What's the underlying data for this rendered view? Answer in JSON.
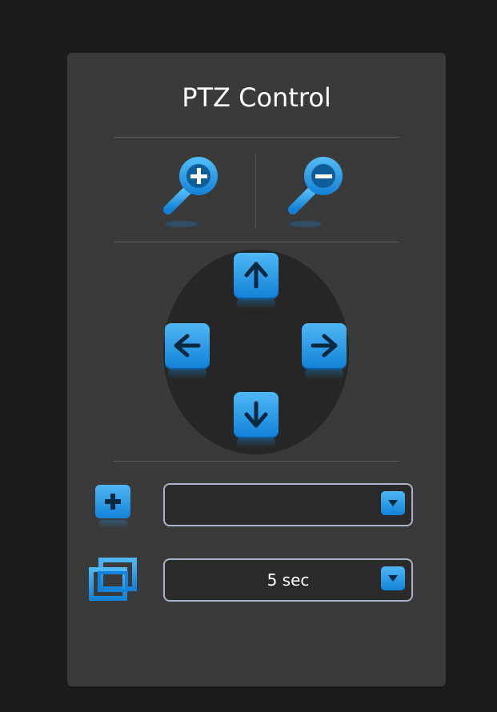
{
  "panel": {
    "title": "PTZ Control"
  },
  "zoom": {
    "zoom_in_icon": "zoom-in-magnifier-icon",
    "zoom_out_icon": "zoom-out-magnifier-icon"
  },
  "pan_tilt": {
    "up_icon": "arrow-up-icon",
    "left_icon": "arrow-left-icon",
    "right_icon": "arrow-right-icon",
    "down_icon": "arrow-down-icon"
  },
  "preset": {
    "add_icon": "plus-icon",
    "selected": ""
  },
  "tour": {
    "icon": "frames-icon",
    "interval_selected": "5 sec"
  },
  "colors": {
    "accent": "#1e96ea",
    "panel_bg": "#3a3a3a",
    "page_bg": "#1b1b1b",
    "select_border": "#a9b4c8"
  }
}
